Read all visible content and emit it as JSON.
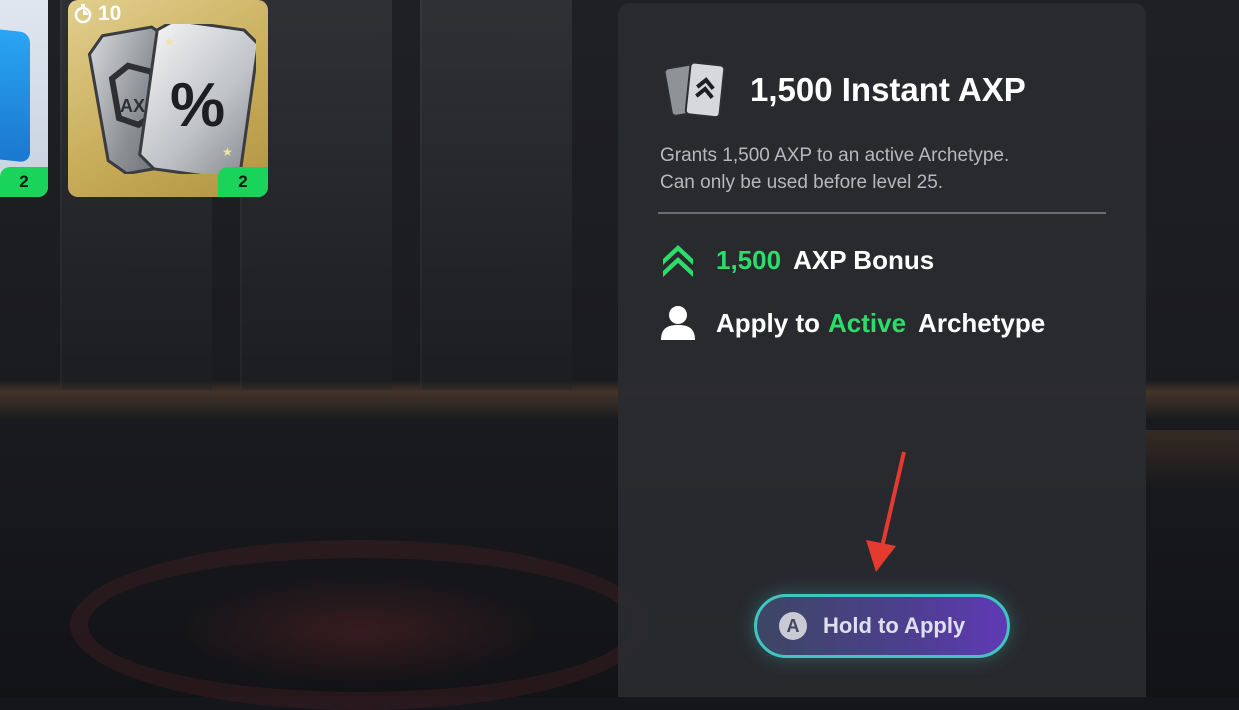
{
  "cards": [
    {
      "name": "blue-card",
      "count": "2"
    },
    {
      "name": "axp-card",
      "timer": "10",
      "count": "2",
      "art_symbol": "%",
      "art_label": "AXP"
    }
  ],
  "item": {
    "title": "1,500 Instant AXP",
    "description_line1": "Grants 1,500 AXP to an active Archetype.",
    "description_line2": "Can only be used before level 25.",
    "bonus_value": "1,500",
    "bonus_label": "AXP Bonus",
    "apply_prefix": "Apply to",
    "apply_highlight": "Active",
    "apply_suffix": "Archetype"
  },
  "button": {
    "key": "A",
    "label": "Hold to Apply"
  },
  "colors": {
    "accent_green": "#2ddc6a",
    "button_border": "#3fc6c0",
    "annotation_arrow": "#e53a2f"
  }
}
